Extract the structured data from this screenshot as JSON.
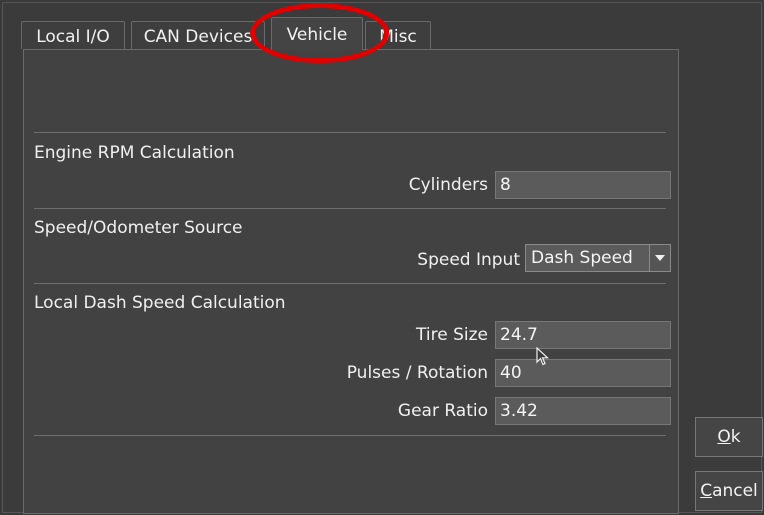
{
  "tabs": [
    {
      "label": "Local I/O"
    },
    {
      "label": "CAN Devices"
    },
    {
      "label": "Vehicle"
    },
    {
      "label": "Misc"
    }
  ],
  "sections": {
    "engine_rpm": {
      "title": "Engine RPM Calculation",
      "cylinders_label": "Cylinders",
      "cylinders_value": "8"
    },
    "speed_source": {
      "title": "Speed/Odometer Source",
      "speed_input_label": "Speed Input",
      "speed_input_value": "Dash Speed"
    },
    "local_dash_speed": {
      "title": "Local Dash Speed Calculation",
      "tire_size_label": "Tire Size",
      "tire_size_value": "24.7",
      "pulses_label": "Pulses / Rotation",
      "pulses_value": "40",
      "gear_ratio_label": "Gear Ratio",
      "gear_ratio_value": "3.42"
    }
  },
  "buttons": {
    "ok_mnemonic": "O",
    "ok_rest": "k",
    "cancel_mnemonic": "C",
    "cancel_rest": "ancel"
  },
  "colors": {
    "highlight_ring": "#e00000"
  }
}
